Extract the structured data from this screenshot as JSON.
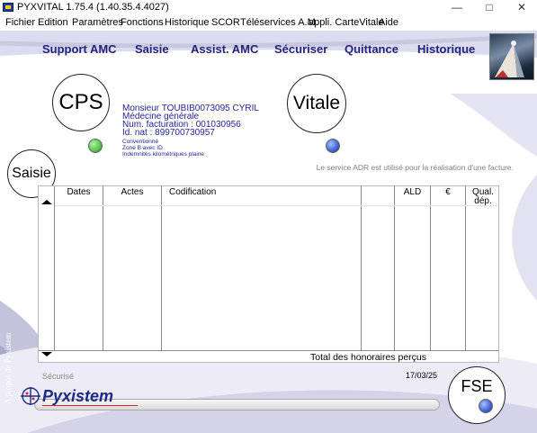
{
  "window": {
    "title": "PYXVITAL 1.75.4 (1.40.35.4.4027)",
    "controls": {
      "minimize": "—",
      "maximize": "□",
      "close": "✕"
    }
  },
  "menu": [
    "Fichier",
    "Edition",
    "Paramètres",
    "Fonctions",
    "Historique",
    "SCOR",
    "Téléservices A.M.",
    "appli. CarteVitale",
    "Aide"
  ],
  "nav": [
    "Support AMC",
    "Saisie",
    "Assist. AMC",
    "Sécuriser",
    "Quittance",
    "Historique"
  ],
  "cps": {
    "label": "CPS",
    "status_color": "#52c34a",
    "doctor": {
      "name": "Monsieur TOUBIB0073095 CYRIL",
      "specialty": "Médecine générale",
      "facturation": "Num. facturation :  001030956",
      "nat": "Id. nat :  899700730957",
      "convention": "Conventionné",
      "zone": "Zone B avec ID",
      "indemnites": "Indemnités kilométriques plaine"
    }
  },
  "vitale": {
    "label": "Vitale",
    "status_color": "#3f63cf"
  },
  "saisie_label": "Saisie",
  "adr_note": "Le service ADR est utilisé pour la réalisation d'une facture.",
  "table": {
    "headers": [
      "Dates",
      "Actes",
      "Codification",
      "",
      "ALD",
      "€",
      "Qual. dép."
    ],
    "rows": [],
    "total_label": "Total des honoraires perçus"
  },
  "status": {
    "left": "Sécurisé",
    "date": "17/03/25"
  },
  "fse": {
    "label": "FSE",
    "status_color": "#3f63cf"
  },
  "brand": {
    "name": "Pyxistem",
    "side_text": "A propos de Pyxistem"
  }
}
